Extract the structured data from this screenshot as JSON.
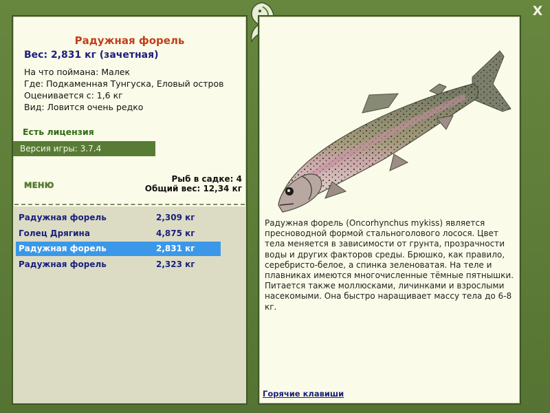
{
  "close_label": "X",
  "fish": {
    "title": "Радужная форель",
    "weight_line": "Вес: 2,831 кг (зачетная)",
    "info": [
      "На что поймана: Малек",
      "Где: Подкаменная Тунгуска, Еловый остров",
      "Оценивается с: 1,6 кг",
      "Вид: Ловится очень редко"
    ],
    "description": "Радужная форель (Oncorhynchus mykiss) является пресноводной формой стальноголового лосося. Цвет тела меняется в зависимости от грунта, прозрачности воды и других факторов среды. Брюшко, как правило, серебристо-белое, а спинка зеленоватая. На теле и плавниках имеются многочисленные тёмные пятнышки. Питается также моллюсками, личинками и взрослыми насекомыми. Она быстро наращивает массу тела до 6-8 кг."
  },
  "license_text": "Есть лицензия",
  "version_text": "Версия игры: 3.7.4",
  "menu_label": "МЕНЮ",
  "cage": {
    "count_line": "Рыб в садке: 4",
    "total_line": "Общий вес: 12,34 кг"
  },
  "catch_list": [
    {
      "name": "Радужная форель",
      "weight": "2,309 кг",
      "selected": false
    },
    {
      "name": "Голец Дрягина",
      "weight": "4,875 кг",
      "selected": false
    },
    {
      "name": "Радужная форель",
      "weight": "2,831 кг",
      "selected": true
    },
    {
      "name": "Радужная форель",
      "weight": "2,323 кг",
      "selected": false
    }
  ],
  "hotkeys_label": "Горячие клавиши",
  "colors": {
    "frame": "#5a7a38",
    "panel": "#fbfbe9",
    "title": "#c0401a",
    "link": "#1a1f7a",
    "selection": "#3b98e8"
  }
}
